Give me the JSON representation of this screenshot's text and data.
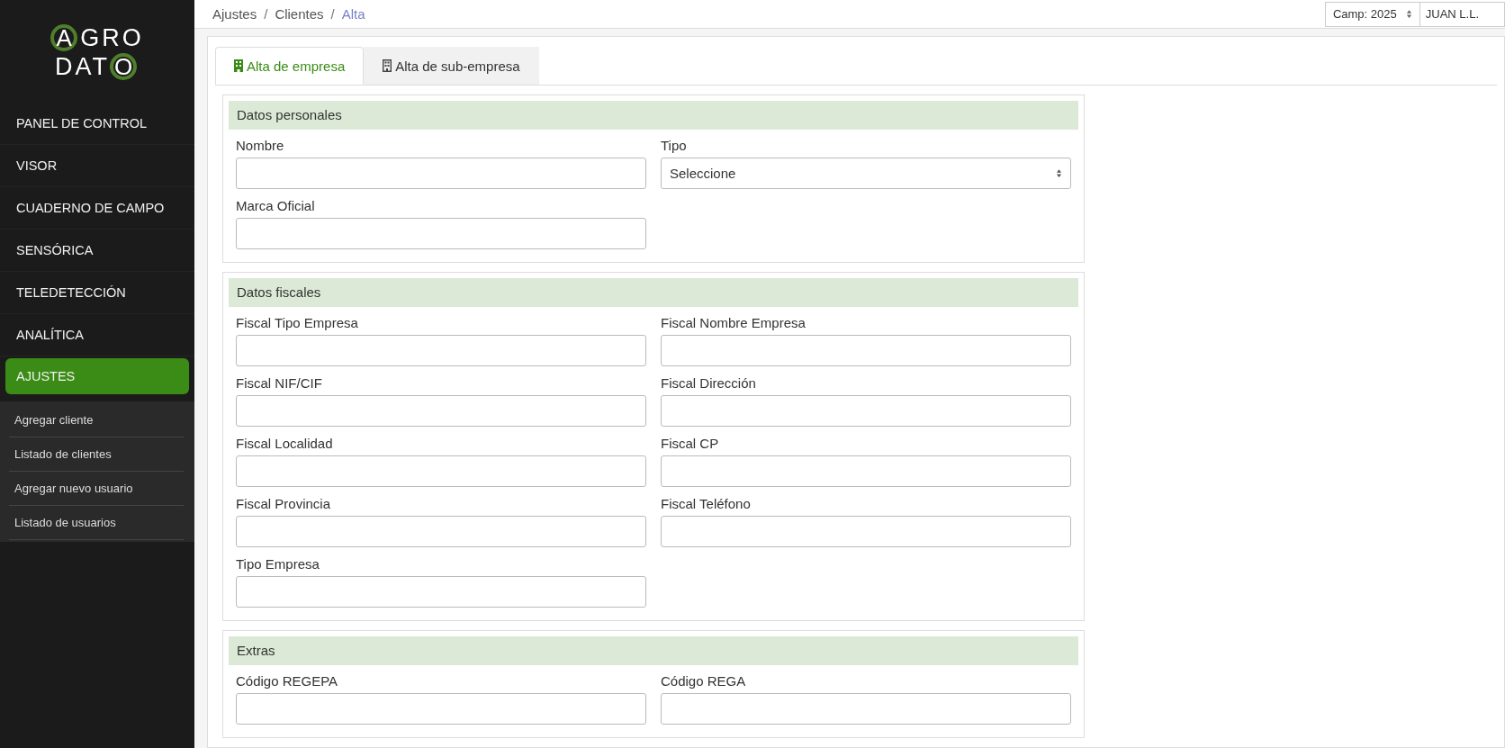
{
  "sidebar": {
    "logo": [
      [
        {
          "text": "A",
          "ringed": true
        },
        {
          "text": "GRO",
          "ringed": false
        }
      ],
      [
        {
          "text": "DAT",
          "ringed": false
        },
        {
          "text": "O",
          "ringed": true
        }
      ]
    ],
    "items": [
      {
        "label": "PANEL DE CONTROL",
        "selected": false
      },
      {
        "label": "VISOR",
        "selected": false
      },
      {
        "label": "CUADERNO DE CAMPO",
        "selected": false
      },
      {
        "label": "SENSÓRICA",
        "selected": false
      },
      {
        "label": "TELEDETECCIÓN",
        "selected": false
      },
      {
        "label": "ANALÍTICA",
        "selected": false
      },
      {
        "label": "AJUSTES",
        "selected": true
      }
    ],
    "submenu": [
      "Agregar cliente",
      "Listado de clientes",
      "Agregar nuevo usuario",
      "Listado de usuarios"
    ]
  },
  "breadcrumb": {
    "separator": "/",
    "items": [
      "Ajustes",
      "Clientes",
      "Alta"
    ]
  },
  "topbar": {
    "campaign": "Camp: 2025",
    "user": "JUAN L.L."
  },
  "tabs": [
    {
      "label": "Alta de empresa",
      "selected": true
    },
    {
      "label": "Alta de sub-empresa",
      "selected": false
    }
  ],
  "sections": [
    {
      "title": "Datos personales",
      "fields": [
        {
          "label": "Nombre",
          "kind": "text"
        },
        {
          "label": "Tipo",
          "kind": "select",
          "value": "Seleccione"
        },
        {
          "label": "Marca Oficial",
          "kind": "text"
        }
      ]
    },
    {
      "title": "Datos fiscales",
      "fields": [
        {
          "label": "Fiscal Tipo Empresa",
          "kind": "text"
        },
        {
          "label": "Fiscal Nombre Empresa",
          "kind": "text"
        },
        {
          "label": "Fiscal NIF/CIF",
          "kind": "text"
        },
        {
          "label": "Fiscal Dirección",
          "kind": "text"
        },
        {
          "label": "Fiscal Localidad",
          "kind": "text"
        },
        {
          "label": "Fiscal CP",
          "kind": "text"
        },
        {
          "label": "Fiscal Provincia",
          "kind": "text"
        },
        {
          "label": "Fiscal Teléfono",
          "kind": "text"
        },
        {
          "label": "Tipo Empresa",
          "kind": "text"
        }
      ]
    },
    {
      "title": "Extras",
      "fields": [
        {
          "label": "Código REGEPA",
          "kind": "text"
        },
        {
          "label": "Código REGA",
          "kind": "text"
        }
      ]
    }
  ]
}
